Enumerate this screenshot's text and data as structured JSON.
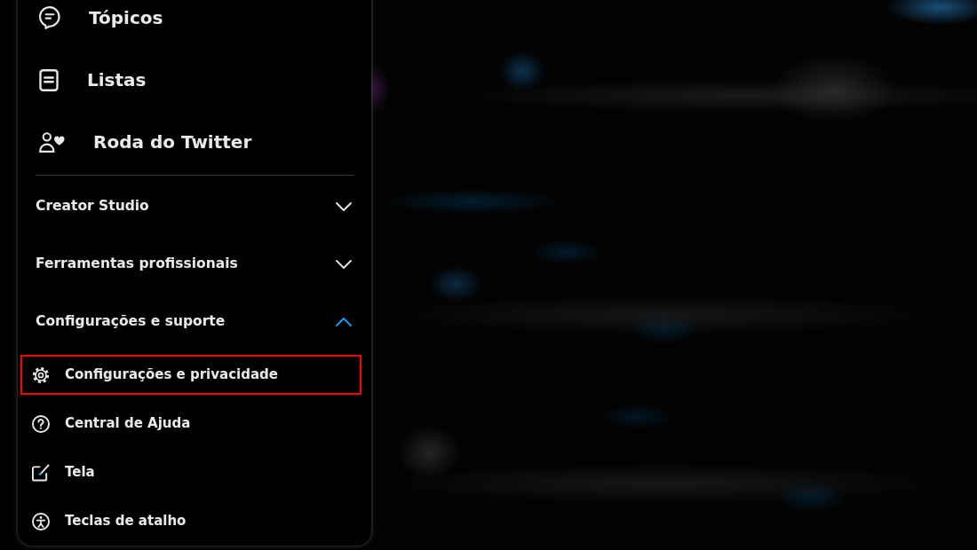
{
  "menu": {
    "items": [
      {
        "label": "Tópicos"
      },
      {
        "label": "Listas"
      },
      {
        "label": "Roda do Twitter"
      }
    ],
    "sections": [
      {
        "label": "Creator Studio",
        "expanded": false
      },
      {
        "label": "Ferramentas profissionais",
        "expanded": false
      },
      {
        "label": "Configurações e suporte",
        "expanded": true,
        "children": [
          {
            "label": "Configurações e privacidade",
            "highlighted": true
          },
          {
            "label": "Central de Ajuda",
            "highlighted": false
          },
          {
            "label": "Tela",
            "highlighted": false
          },
          {
            "label": "Teclas de atalho",
            "highlighted": false
          }
        ]
      }
    ]
  }
}
